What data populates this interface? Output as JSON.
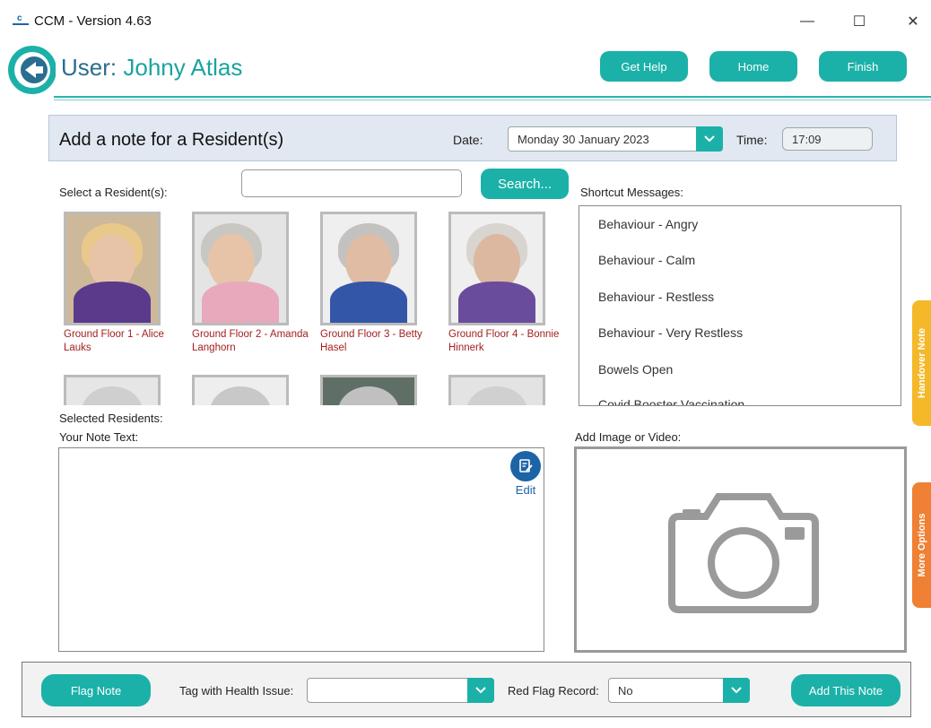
{
  "window": {
    "title": "CCM - Version 4.63",
    "minimize_glyph": "—",
    "maximize_glyph": "☐",
    "close_glyph": "✕"
  },
  "header": {
    "user_prefix": "User:",
    "user_name": "Johny Atlas",
    "buttons": {
      "help": "Get Help",
      "home": "Home",
      "finish": "Finish"
    }
  },
  "note_bar": {
    "title": "Add a note for a Resident(s)",
    "date_label": "Date:",
    "date_value": "Monday 30 January 2023",
    "time_label": "Time:",
    "time_value": "17:09"
  },
  "residents_section": {
    "label": "Select a Resident(s):",
    "search_value": "",
    "search_button": "Search...",
    "residents": [
      {
        "caption": "Ground Floor 1 - Alice Lauks"
      },
      {
        "caption": "Ground Floor 2 - Amanda Langhorn"
      },
      {
        "caption": "Ground Floor 3 - Betty Hasel"
      },
      {
        "caption": "Ground Floor 4 - Bonnie Hinnerk"
      }
    ],
    "selected_label": "Selected Residents:"
  },
  "shortcuts": {
    "label": "Shortcut Messages:",
    "items": [
      "Behaviour - Angry",
      "Behaviour - Calm",
      "Behaviour - Restless",
      "Behaviour - Very Restless",
      "Bowels Open",
      "Covid Booster Vaccination"
    ]
  },
  "note": {
    "label": "Your Note Text:",
    "value": "",
    "edit_label": "Edit"
  },
  "media": {
    "label": "Add Image or Video:",
    "icon": "camera-icon"
  },
  "side_tabs": {
    "handover": "Handover Note",
    "more": "More Options"
  },
  "bottom_bar": {
    "flag_button": "Flag Note",
    "health_label": "Tag with Health Issue:",
    "health_value": "",
    "red_flag_label": "Red Flag Record:",
    "red_flag_value": "No",
    "add_button": "Add This Note"
  },
  "colors": {
    "accent": "#1bb1a8",
    "caption_red": "#a31f1f",
    "handover_tab": "#f5b829",
    "more_tab": "#ef8034",
    "edit_blue": "#1d64a6"
  }
}
